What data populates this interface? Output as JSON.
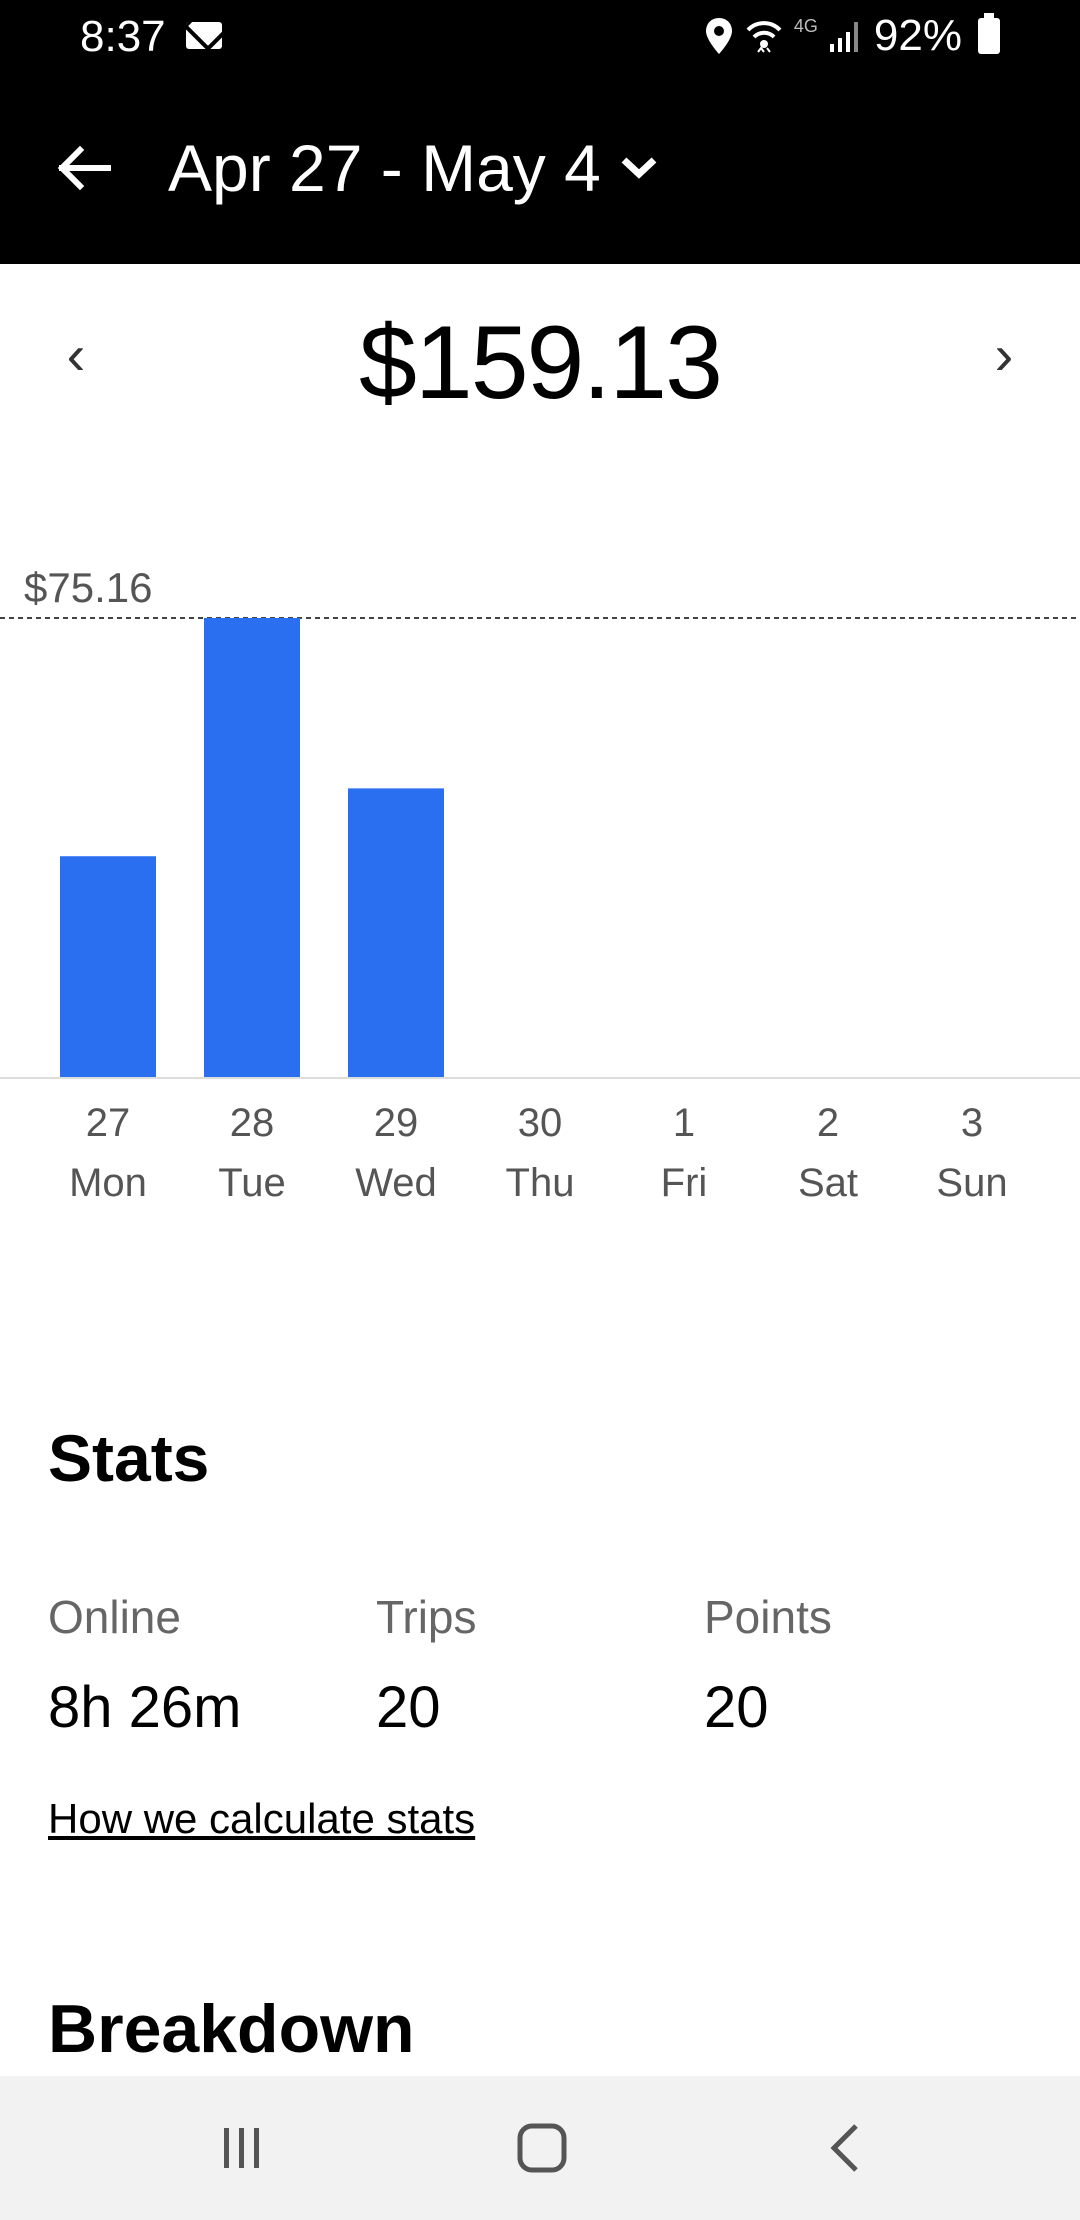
{
  "status_bar": {
    "time": "8:37",
    "network": "4G",
    "battery": "92%"
  },
  "header": {
    "period": "Apr 27 - May 4"
  },
  "summary": {
    "total": "$159.13"
  },
  "chart_data": {
    "type": "bar",
    "max_label": "$75.16",
    "categories": [
      {
        "date": "27",
        "day": "Mon"
      },
      {
        "date": "28",
        "day": "Tue"
      },
      {
        "date": "29",
        "day": "Wed"
      },
      {
        "date": "30",
        "day": "Thu"
      },
      {
        "date": "1",
        "day": "Fri"
      },
      {
        "date": "2",
        "day": "Sat"
      },
      {
        "date": "3",
        "day": "Sun"
      }
    ],
    "values": [
      36.15,
      75.16,
      47.26,
      0,
      0,
      0,
      0
    ],
    "ylim": [
      0,
      75.16
    ],
    "bar_color": "#2a6ff0"
  },
  "stats": {
    "title": "Stats",
    "items": [
      {
        "label": "Online",
        "value": "8h 26m"
      },
      {
        "label": "Trips",
        "value": "20"
      },
      {
        "label": "Points",
        "value": "20"
      }
    ],
    "link": "How we calculate stats"
  },
  "breakdown": {
    "title": "Breakdown"
  }
}
